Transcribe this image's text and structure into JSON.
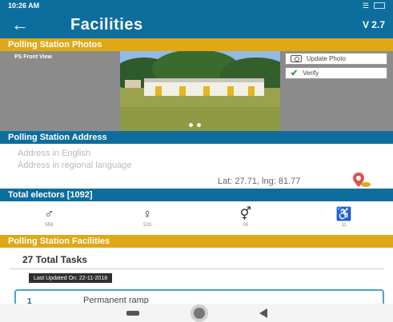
{
  "status_bar": {
    "time": "10:26 AM",
    "battery": "68%"
  },
  "app_bar": {
    "title": "Facilities",
    "version": "V 2.7"
  },
  "sections": {
    "photos": "Polling Station Photos",
    "address": "Polling Station Address",
    "electors": "Total electors [1092]",
    "facilities": "Polling Station Facilities"
  },
  "photos": {
    "caption": "PS Front View",
    "update_label": "Update Photo",
    "verify_label": "Verify",
    "carousel_pages": 2
  },
  "address": {
    "english": "Address in English",
    "regional": "Address in regional language",
    "latlng": "Lat: 27.71, lng: 81.77"
  },
  "electors": [
    {
      "icon": "male-icon",
      "value": "559"
    },
    {
      "icon": "female-icon",
      "value": "533"
    },
    {
      "icon": "third-gender-icon",
      "value": "00"
    },
    {
      "icon": "pwd-icon",
      "value": "11"
    }
  ],
  "facilities": {
    "total_tasks": "27 Total Tasks",
    "last_updated": "Last Updated On: 22-11-2018",
    "tasks": [
      {
        "number": "1",
        "label": "Permanent ramp"
      }
    ]
  },
  "colors": {
    "primary": "#0d6e9e",
    "accent": "#e0a817",
    "verify": "#2e9e37",
    "card_border": "#4aa3c8"
  }
}
